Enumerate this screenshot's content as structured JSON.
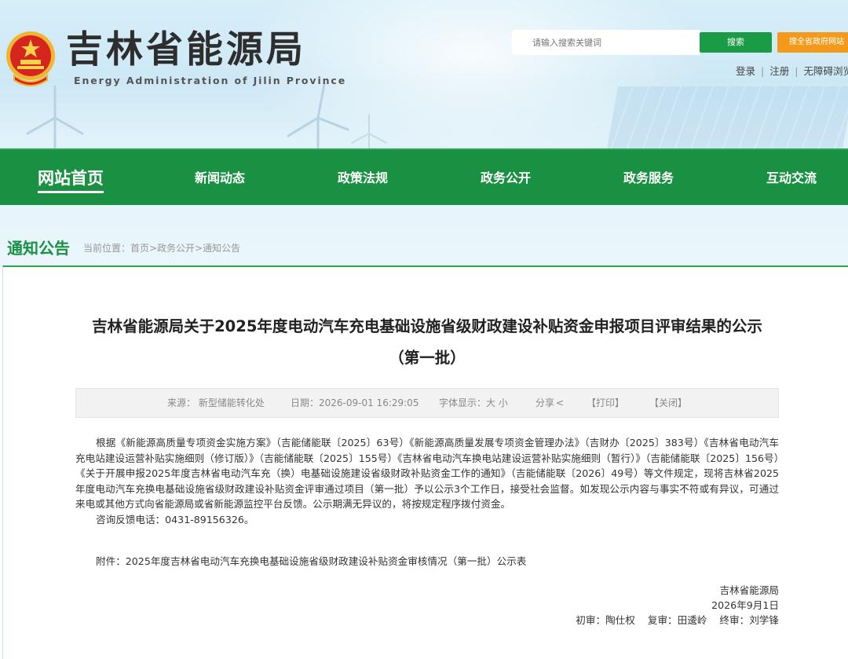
{
  "header": {
    "site_title": "吉林省能源局",
    "site_subtitle": "Energy Administration of Jilin Province",
    "emblem_icon": "national-emblem-icon",
    "search_placeholder": "请输入搜索关键词",
    "search_button": "搜索",
    "province_search_button": "搜全省政府网站",
    "links": [
      "登录",
      "注册",
      "无障碍浏览"
    ]
  },
  "nav": {
    "items": [
      "网站首页",
      "新闻动态",
      "政策法规",
      "政务公开",
      "政务服务",
      "互动交流"
    ],
    "active": "网站首页"
  },
  "breadcrumb": {
    "section_title": "通知公告",
    "path": "当前位置：首页>政务公开>通知公告"
  },
  "article": {
    "title_line1": "吉林省能源局关于2025年度电动汽车充电基础设施省级财政建设补贴资金申报项目评审结果的公示",
    "title_line2": "（第一批）",
    "meta": {
      "source": "来源：  新型储能转化处",
      "date": "日期：2026-09-01 16:29:05",
      "font_size": "字体显示：大  小",
      "share": "分享",
      "print": "【打印】",
      "close": "【关闭】"
    },
    "body_paragraph": "根据《新能源高质量专项资金实施方案》（吉能储能联〔2025〕63号）《新能源高质量发展专项资金管理办法》（吉财办〔2025〕383号）《吉林省电动汽车充电站建设运营补贴实施细则（修订版）》（吉能储能联〔2025〕155号）《吉林省电动汽车换电站建设运营补贴实施细则（暂行）》（吉能储能联〔2025〕156号）《关于开展申报2025年度吉林省电动汽车充（换）电基础设施建设省级财政补贴资金工作的通知》（吉能储能联〔2026〕49号）等文件规定，现将吉林省2025年度电动汽车充换电基础设施省级财政建设补贴资金评审通过项目（第一批）予以公示3个工作日，接受社会监督。如发现公示内容与事实不符或有异议，可通过来电或其他方式向省能源局或省新能源监控平台反馈。公示期满无异议的，将按规定程序拨付资金。",
    "hotline": "咨询反馈电话：0431-89156326。",
    "attachment": "附件：2025年度吉林省电动汽车充换电基础设施省级财政建设补贴资金审核情况（第一批）公示表",
    "signature": {
      "org": "吉林省能源局",
      "date": "2026年9月1日",
      "reviewers": "初审：陶仕权    复审：田逶岭    终审：刘学锋"
    }
  },
  "colors": {
    "nav_green": "#1a9142",
    "search_green": "#1a9b45",
    "orange": "#f39a1d"
  }
}
